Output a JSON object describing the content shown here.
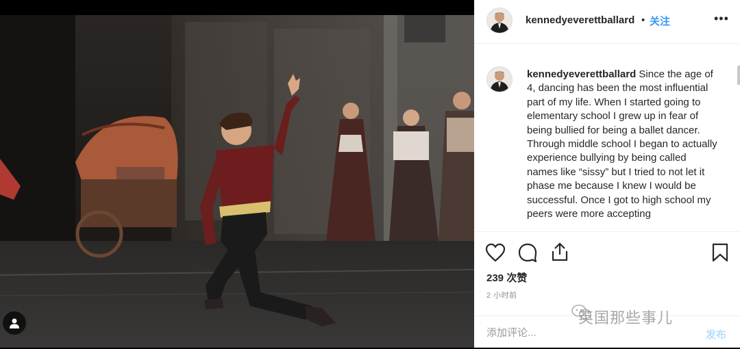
{
  "header": {
    "username": "kennedyeverettballard",
    "separator": "•",
    "follow_label": "关注",
    "more_label": "•••"
  },
  "caption": {
    "username": "kennedyeverettballard",
    "text": "Since the age of 4, dancing has been the most influential part of my life. When I started going to elementary school I grew up in fear of being bullied for being a ballet dancer. Through middle school I began to actually experience bullying by being called names like “sissy” but I tried to not let it phase me because I knew I would be successful. Once I got to high school my peers were more accepting"
  },
  "stats": {
    "likes": "239 次赞",
    "time": "2 小时前"
  },
  "comment": {
    "placeholder": "添加评论...",
    "post_label": "发布"
  },
  "watermark": {
    "text": "英国那些事儿"
  },
  "icons": {
    "like": "heart-icon",
    "comment": "comment-bubble-icon",
    "share": "share-icon",
    "save": "bookmark-icon",
    "tag": "user-tag-icon"
  },
  "colors": {
    "follow": "#3897f0",
    "post_disabled": "#b2dffc",
    "text": "#262626",
    "muted": "#8e8e8e"
  }
}
